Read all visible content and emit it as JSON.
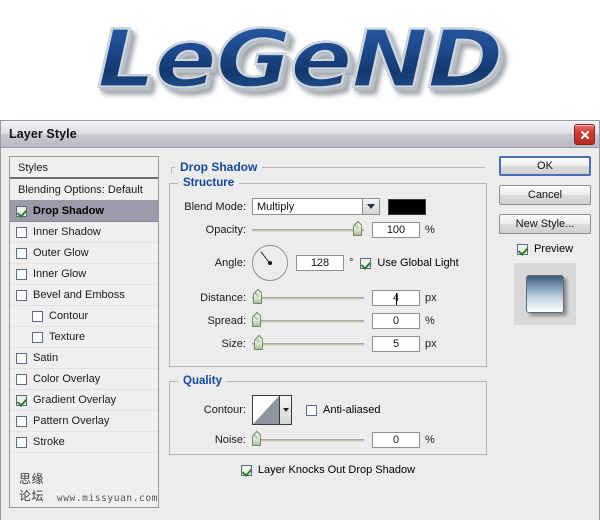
{
  "banner": {
    "logo_text": "LeGeND",
    "logo_color": "#1b4486",
    "bevel_color": "#cfd5dc"
  },
  "dialog": {
    "title": "Layer Style",
    "close_icon": "close-icon"
  },
  "styles_panel": {
    "header": "Styles",
    "blending_options": "Blending Options: Default",
    "items": [
      {
        "label": "Drop Shadow",
        "checked": true,
        "selected": true,
        "indent": false
      },
      {
        "label": "Inner Shadow",
        "checked": false,
        "selected": false,
        "indent": false
      },
      {
        "label": "Outer Glow",
        "checked": false,
        "selected": false,
        "indent": false
      },
      {
        "label": "Inner Glow",
        "checked": false,
        "selected": false,
        "indent": false
      },
      {
        "label": "Bevel and Emboss",
        "checked": false,
        "selected": false,
        "indent": false
      },
      {
        "label": "Contour",
        "checked": false,
        "selected": false,
        "indent": true
      },
      {
        "label": "Texture",
        "checked": false,
        "selected": false,
        "indent": true
      },
      {
        "label": "Satin",
        "checked": false,
        "selected": false,
        "indent": false
      },
      {
        "label": "Color Overlay",
        "checked": false,
        "selected": false,
        "indent": false
      },
      {
        "label": "Gradient Overlay",
        "checked": true,
        "selected": false,
        "indent": false
      },
      {
        "label": "Pattern Overlay",
        "checked": false,
        "selected": false,
        "indent": false
      },
      {
        "label": "Stroke",
        "checked": false,
        "selected": false,
        "indent": false
      }
    ],
    "watermark_cn": "思缘论坛",
    "watermark_url": "www.missyuan.com"
  },
  "drop_shadow": {
    "section_title": "Drop Shadow",
    "structure": {
      "title": "Structure",
      "blend_mode_label": "Blend Mode:",
      "blend_mode_value": "Multiply",
      "blend_mode_options": "Multiply",
      "shadow_color": "#000000",
      "opacity_label": "Opacity:",
      "opacity_value": "100",
      "opacity_unit": "%",
      "angle_label": "Angle:",
      "angle_value": "128",
      "angle_unit": "°",
      "use_global_light_label": "Use Global Light",
      "use_global_light_checked": true,
      "distance_label": "Distance:",
      "distance_value": "4",
      "distance_unit": "px",
      "spread_label": "Spread:",
      "spread_value": "0",
      "spread_unit": "%",
      "size_label": "Size:",
      "size_value": "5",
      "size_unit": "px"
    },
    "quality": {
      "title": "Quality",
      "contour_label": "Contour:",
      "anti_aliased_label": "Anti-aliased",
      "anti_aliased_checked": false,
      "noise_label": "Noise:",
      "noise_value": "0",
      "noise_unit": "%",
      "knockout_label": "Layer Knocks Out Drop Shadow",
      "knockout_checked": true
    }
  },
  "buttons": {
    "ok": "OK",
    "cancel": "Cancel",
    "new_style": "New Style...",
    "preview_label": "Preview",
    "preview_checked": true
  }
}
